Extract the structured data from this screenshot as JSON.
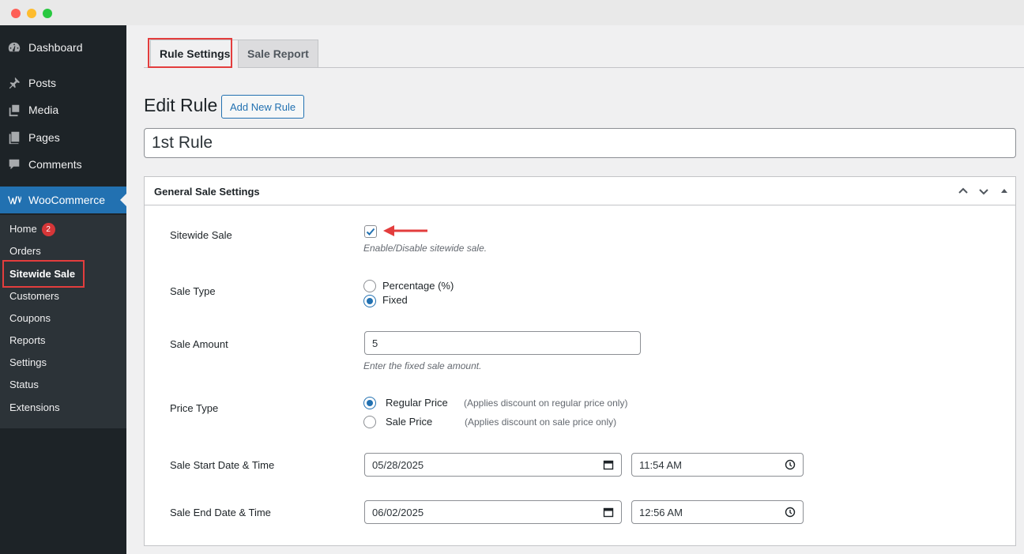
{
  "sidebar": {
    "menu": [
      {
        "label": "Dashboard",
        "icon": "dashboard-icon"
      },
      {
        "label": "Posts",
        "icon": "pin-icon"
      },
      {
        "label": "Media",
        "icon": "media-icon"
      },
      {
        "label": "Pages",
        "icon": "pages-icon"
      },
      {
        "label": "Comments",
        "icon": "comment-icon"
      },
      {
        "label": "WooCommerce",
        "icon": "woocommerce-icon"
      }
    ],
    "submenu": [
      {
        "label": "Home",
        "badge": "2"
      },
      {
        "label": "Orders"
      },
      {
        "label": "Sitewide Sale"
      },
      {
        "label": "Customers"
      },
      {
        "label": "Coupons"
      },
      {
        "label": "Reports"
      },
      {
        "label": "Settings"
      },
      {
        "label": "Status"
      },
      {
        "label": "Extensions"
      }
    ]
  },
  "tabs": [
    {
      "label": "Rule Settings"
    },
    {
      "label": "Sale Report"
    }
  ],
  "page": {
    "title": "Edit Rule",
    "add_new_label": "Add New Rule",
    "rule_name": "1st Rule"
  },
  "panel": {
    "title": "General Sale Settings",
    "sitewide": {
      "label": "Sitewide Sale",
      "checked": true,
      "description": "Enable/Disable sitewide sale."
    },
    "sale_type": {
      "label": "Sale Type",
      "options": [
        "Percentage (%)",
        "Fixed"
      ],
      "selected": "Fixed"
    },
    "sale_amount": {
      "label": "Sale Amount",
      "value": "5",
      "description": "Enter the fixed sale amount."
    },
    "price_type": {
      "label": "Price Type",
      "options": [
        {
          "label": "Regular Price",
          "note": "(Applies discount on regular price only)"
        },
        {
          "label": "Sale Price",
          "note": "(Applies discount on sale price only)"
        }
      ],
      "selected": "Regular Price"
    },
    "start": {
      "label": "Sale Start Date & Time",
      "date": "05/28/2025",
      "time": "11:54  AM"
    },
    "end": {
      "label": "Sale End Date & Time",
      "date": "06/02/2025",
      "time": "12:56  AM"
    }
  },
  "colors": {
    "accent": "#2271b1",
    "sidebar_bg": "#1d2327",
    "highlight": "#e33d3d"
  }
}
